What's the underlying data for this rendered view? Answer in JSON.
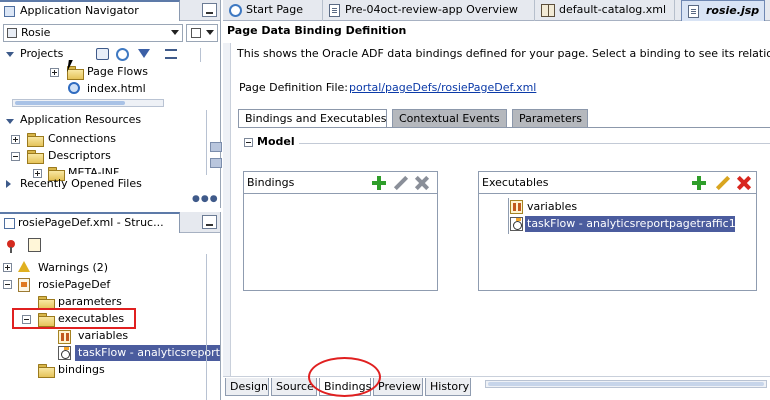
{
  "navigator": {
    "title": "Application Navigator",
    "app_name": "Rosie",
    "projects_label": "Projects",
    "project_items": [
      "Page Flows",
      "index.html"
    ],
    "app_resources_label": "Application Resources",
    "resource_items": [
      "Connections",
      "Descriptors",
      "META-INF"
    ],
    "recent_files_label": "Recently Opened Files"
  },
  "structure": {
    "title": "rosiePageDef.xml - Struc...",
    "items": [
      "Warnings (2)",
      "rosiePageDef",
      "parameters",
      "executables",
      "variables",
      "taskFlow - analyticsreportp",
      "bindings"
    ]
  },
  "editor_tabs": [
    "Start Page",
    "Pre-04oct-review-app Overview",
    "default-catalog.xml",
    "rosie.jsp"
  ],
  "editor": {
    "title": "Page Data Binding Definition",
    "description": "This shows the Oracle ADF data bindings defined for your page.  Select a binding to see its relationshi",
    "page_def_label": "Page Definition File:",
    "page_def_link": "portal/pageDefs/rosiePageDef.xml",
    "subtabs": [
      "Bindings and Executables",
      "Contextual Events",
      "Parameters"
    ],
    "model_label": "Model",
    "bindings_box_title": "Bindings",
    "executables_box_title": "Executables",
    "executables": [
      "variables",
      "taskFlow - analyticsreportpagetraffic1"
    ],
    "bottom_tabs": [
      "Design",
      "Source",
      "Bindings",
      "Preview",
      "History"
    ]
  },
  "colors": {
    "selection": "#4b5c9e",
    "annotation": "#e02020",
    "link": "#0b3aa8"
  }
}
